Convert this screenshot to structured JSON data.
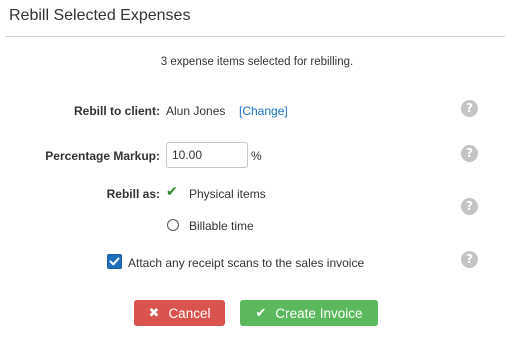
{
  "dialog": {
    "title": "Rebill Selected Expenses",
    "summary": "3 expense items selected for rebilling."
  },
  "client": {
    "label": "Rebill to client:",
    "name": "Alun Jones",
    "change_link": "[Change]"
  },
  "markup": {
    "label": "Percentage Markup:",
    "value": "10.00",
    "unit": "%"
  },
  "rebill_as": {
    "label": "Rebill as:",
    "options": [
      {
        "label": "Physical items",
        "selected": true
      },
      {
        "label": "Billable time",
        "selected": false
      }
    ]
  },
  "attach": {
    "label": "Attach any receipt scans to the sales invoice",
    "checked": true
  },
  "help_icon": "?",
  "buttons": {
    "cancel_label": "Cancel",
    "cancel_icon": "✖",
    "create_label": "Create Invoice",
    "create_icon": "✔"
  },
  "colors": {
    "cancel": "#d9534f",
    "create": "#5cb85c",
    "link": "#1a73c5",
    "check": "#2a8a2a"
  }
}
